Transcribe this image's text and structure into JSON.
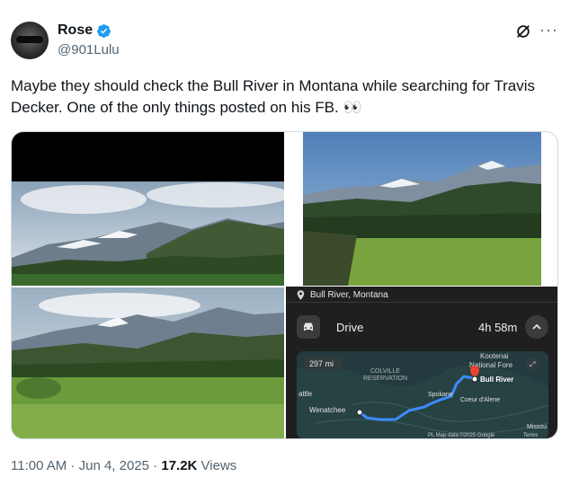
{
  "author": {
    "name": "Rose",
    "handle": "@901Lulu"
  },
  "tweet": {
    "text": "Maybe they should check the Bull River in Montana while searching for Travis Decker. One of the only things posted on his FB. 👀"
  },
  "map": {
    "location": "Bull River, Montana",
    "mode": "Drive",
    "duration": "4h 58m",
    "distance": "297 mi",
    "labels": {
      "reservation": "COLVILLE\nRESERVATION",
      "kootenai": "Kootenai",
      "forest": "National Fore",
      "destination": "Bull River",
      "spokane": "Spokane",
      "coeur": "Coeur d'Alene",
      "seattle": "attle",
      "wenatchee": "Wenatchee",
      "missou": "Missou",
      "attribution": "PL Map data ©2025 Google",
      "terms": "Terms"
    }
  },
  "footer": {
    "time": "11:00 AM",
    "sep1": " · ",
    "date": "Jun 4, 2025",
    "sep2": " · ",
    "views_count": "17.2K",
    "views_label": " Views"
  },
  "colors": {
    "verified": "#1d9bf0",
    "text": "#0f1419",
    "muted": "#536471",
    "route": "#3d8bff",
    "pin": "#ea4335"
  }
}
